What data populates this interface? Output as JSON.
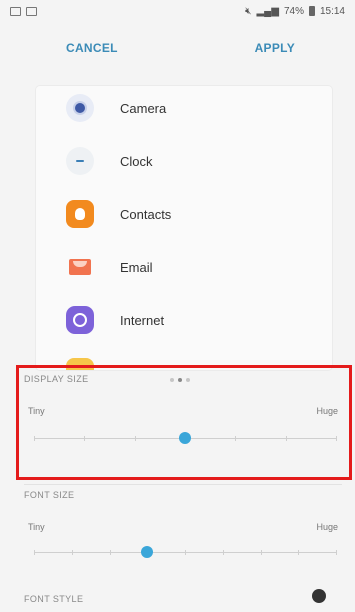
{
  "status_bar": {
    "battery": "74%",
    "time": "15:14"
  },
  "actions": {
    "cancel_label": "CANCEL",
    "apply_label": "APPLY"
  },
  "preview": {
    "apps": [
      {
        "label": "Camera",
        "icon": "camera-icon"
      },
      {
        "label": "Clock",
        "icon": "clock-icon"
      },
      {
        "label": "Contacts",
        "icon": "contacts-icon"
      },
      {
        "label": "Email",
        "icon": "email-icon"
      },
      {
        "label": "Internet",
        "icon": "internet-icon"
      }
    ],
    "page_dots": {
      "count": 3,
      "active_index": 1
    }
  },
  "display_size": {
    "title": "DISPLAY SIZE",
    "min_label": "Tiny",
    "max_label": "Huge",
    "steps": 7,
    "selected_step": 3
  },
  "font_size": {
    "title": "FONT SIZE",
    "min_label": "Tiny",
    "max_label": "Huge",
    "steps": 9,
    "selected_step": 3
  },
  "font_style": {
    "title": "FONT STYLE"
  },
  "colors": {
    "accent": "#3aa6d9",
    "action_text": "#3b8bb7",
    "highlight": "#e41b1b"
  }
}
